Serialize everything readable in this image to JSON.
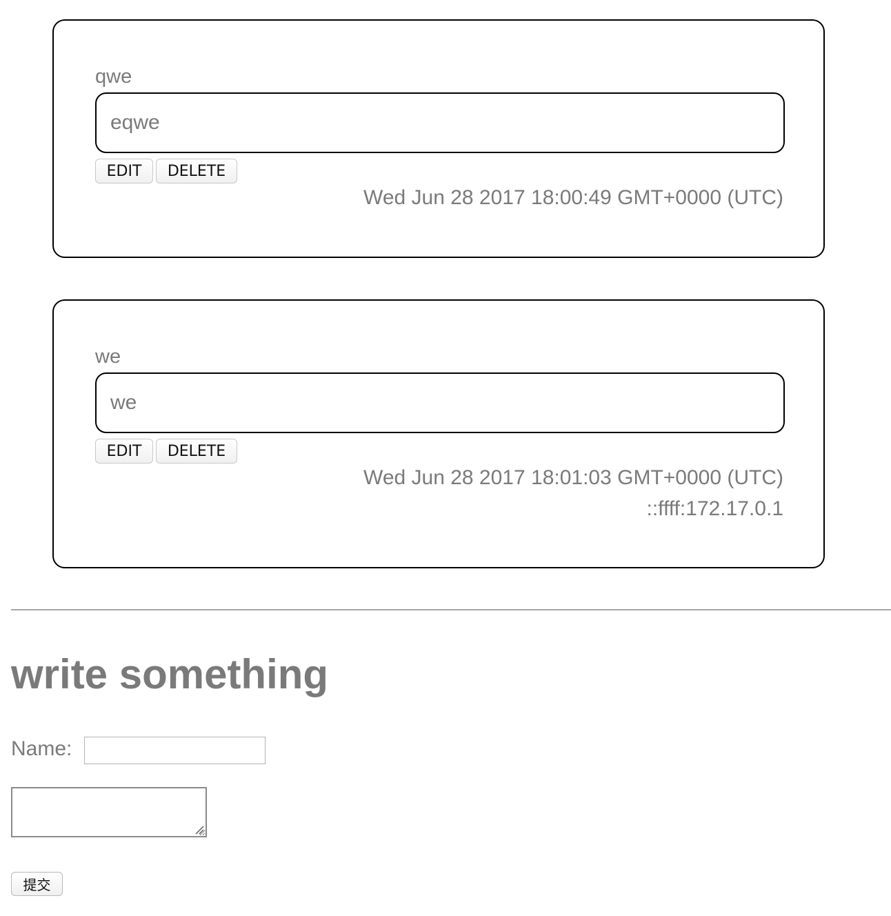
{
  "messages": [
    {
      "name": "qwe",
      "content": "eqwe",
      "edit_label": "EDIT",
      "delete_label": "DELETE",
      "timestamp": "Wed Jun 28 2017 18:00:49 GMT+0000 (UTC)",
      "ip": ""
    },
    {
      "name": "we",
      "content": "we",
      "edit_label": "EDIT",
      "delete_label": "DELETE",
      "timestamp": "Wed Jun 28 2017 18:01:03 GMT+0000 (UTC)",
      "ip": "::ffff:172.17.0.1"
    }
  ],
  "form": {
    "title": "write something",
    "name_label": "Name:",
    "name_value": "",
    "message_value": "",
    "submit_label": "提交"
  },
  "colors": {
    "text": "#7a7a7a",
    "border": "#000000",
    "divider": "#a6a6a6"
  }
}
